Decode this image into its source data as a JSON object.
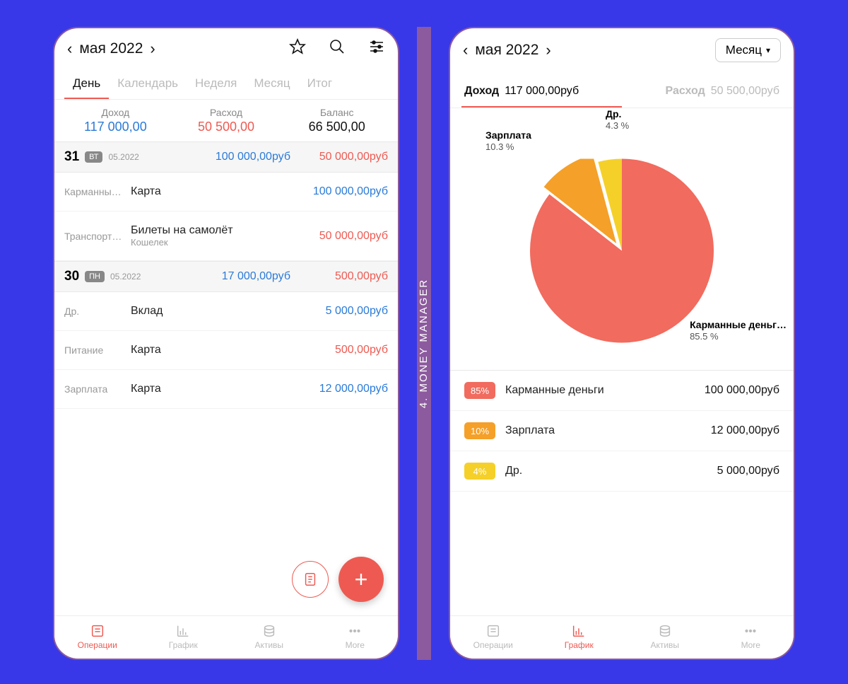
{
  "spine": "4. MONEY MANAGER",
  "colors": {
    "income": "#2a7ad8",
    "expense": "#ee5a52",
    "salary": "#f5a028",
    "other": "#f5d028",
    "pocket": "#f16b5e"
  },
  "left": {
    "month": "мая 2022",
    "tabs": [
      "День",
      "Календарь",
      "Неделя",
      "Месяц",
      "Итог"
    ],
    "activeTab": 0,
    "summary": {
      "income_label": "Доход",
      "income": "117 000,00",
      "expense_label": "Расход",
      "expense": "50 500,00",
      "balance_label": "Баланс",
      "balance": "66 500,00"
    },
    "days": [
      {
        "num": "31",
        "dow": "ВТ",
        "date": "05.2022",
        "income": "100 000,00руб",
        "expense": "50 000,00руб",
        "tx": [
          {
            "cat": "Карманные…",
            "title": "Карта",
            "sub": "",
            "amt": "100 000,00руб",
            "type": "inc"
          },
          {
            "cat": "Транспортн…",
            "title": "Билеты на самолёт",
            "sub": "Кошелек",
            "amt": "50 000,00руб",
            "type": "exp"
          }
        ]
      },
      {
        "num": "30",
        "dow": "ПН",
        "date": "05.2022",
        "income": "17 000,00руб",
        "expense": "500,00руб",
        "tx": [
          {
            "cat": "Др.",
            "title": "Вклад",
            "sub": "",
            "amt": "5 000,00руб",
            "type": "inc"
          },
          {
            "cat": "Питание",
            "title": "Карта",
            "sub": "",
            "amt": "500,00руб",
            "type": "exp"
          },
          {
            "cat": "Зарплата",
            "title": "Карта",
            "sub": "",
            "amt": "12 000,00руб",
            "type": "inc"
          }
        ]
      }
    ],
    "bottomnav": [
      "Операции",
      "График",
      "Активы",
      "More"
    ],
    "bottomActive": 0
  },
  "right": {
    "month": "мая 2022",
    "periodBtn": "Месяц",
    "ie": {
      "income_label": "Доход",
      "income_val": "117 000,00руб",
      "expense_label": "Расход",
      "expense_val": "50 500,00руб",
      "active": "income"
    },
    "pieLabels": {
      "pocket": {
        "name": "Карманные деньг…",
        "pct": "85.5 %"
      },
      "salary": {
        "name": "Зарплата",
        "pct": "10.3 %"
      },
      "other": {
        "name": "Др.",
        "pct": "4.3 %"
      }
    },
    "legend": [
      {
        "pct": "85%",
        "name": "Карманные деньги",
        "amt": "100 000,00руб",
        "color": "#f16b5e"
      },
      {
        "pct": "10%",
        "name": "Зарплата",
        "amt": "12 000,00руб",
        "color": "#f5a028"
      },
      {
        "pct": "4%",
        "name": "Др.",
        "amt": "5 000,00руб",
        "color": "#f5d028"
      }
    ],
    "bottomnav": [
      "Операции",
      "График",
      "Активы",
      "More"
    ],
    "bottomActive": 1
  },
  "chart_data": {
    "type": "pie",
    "title": "Доход мая 2022",
    "categories": [
      "Карманные деньги",
      "Зарплата",
      "Др."
    ],
    "values": [
      100000,
      12000,
      5000
    ],
    "percentages": [
      85.5,
      10.3,
      4.3
    ],
    "colors": [
      "#f16b5e",
      "#f5a028",
      "#f5d028"
    ]
  }
}
